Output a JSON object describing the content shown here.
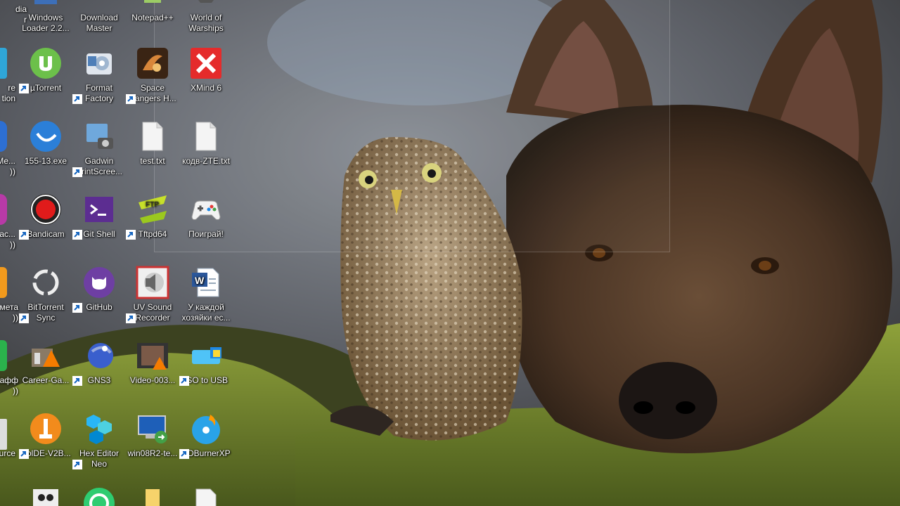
{
  "desktop": {
    "col0_labels": [
      "dia\nr",
      "re\ntion",
      "Me...\n))",
      "ас...\n))",
      "мета\n))",
      "кафф\n))",
      "urce"
    ],
    "icons": [
      {
        "key": "windows-loader",
        "label": "Windows Loader 2.2...",
        "icon": "windows-loader-icon"
      },
      {
        "key": "download-master",
        "label": "Download Master",
        "icon": "download-master-icon"
      },
      {
        "key": "notepad-plus",
        "label": "Notepad++",
        "icon": "notepad-plus-icon"
      },
      {
        "key": "world-of-warships",
        "label": "World of Warships",
        "icon": "world-of-warships-icon"
      },
      {
        "key": "utorrent",
        "label": "µTorrent",
        "icon": "utorrent-icon"
      },
      {
        "key": "format-factory",
        "label": "Format Factory",
        "icon": "format-factory-icon"
      },
      {
        "key": "space-rangers",
        "label": "Space Rangers H...",
        "icon": "space-rangers-icon"
      },
      {
        "key": "xmind",
        "label": "XMind 6",
        "icon": "xmind-icon"
      },
      {
        "key": "file-155",
        "label": "155-13.exe",
        "icon": "exe-icon"
      },
      {
        "key": "gadwin",
        "label": "Gadwin PrintScree...",
        "icon": "gadwin-icon"
      },
      {
        "key": "test-txt",
        "label": "test.txt",
        "icon": "text-file-icon"
      },
      {
        "key": "kodv-zte",
        "label": "кодв-ZTE.txt",
        "icon": "text-file-icon"
      },
      {
        "key": "bandicam",
        "label": "Bandicam",
        "icon": "bandicam-icon"
      },
      {
        "key": "git-shell",
        "label": "Git Shell",
        "icon": "git-shell-icon"
      },
      {
        "key": "tftpd64",
        "label": "Tftpd64",
        "icon": "tftpd-icon"
      },
      {
        "key": "pograi",
        "label": "Поиграй!",
        "icon": "gamepad-icon"
      },
      {
        "key": "bittorrent-sync",
        "label": "BitTorrent Sync",
        "icon": "bittorrent-sync-icon"
      },
      {
        "key": "github",
        "label": "GitHub",
        "icon": "github-icon"
      },
      {
        "key": "uv-sound",
        "label": "UV Sound Recorder",
        "icon": "uv-sound-icon"
      },
      {
        "key": "u-kazhdoy",
        "label": "У каждой хозяйки ес...",
        "icon": "word-doc-icon"
      },
      {
        "key": "career-game",
        "label": "Career-Ga...",
        "icon": "career-game-icon"
      },
      {
        "key": "gns3",
        "label": "GNS3",
        "icon": "gns3-icon"
      },
      {
        "key": "video-003",
        "label": "Video-003...",
        "icon": "video-file-icon"
      },
      {
        "key": "iso-to-usb",
        "label": "ISO to USB",
        "icon": "iso-to-usb-icon"
      },
      {
        "key": "colde",
        "label": "ColDE-V2B...",
        "icon": "colde-icon"
      },
      {
        "key": "hex-editor",
        "label": "Hex Editor Neo",
        "icon": "hex-editor-icon"
      },
      {
        "key": "win08r2",
        "label": "win08R2-te...",
        "icon": "rdp-icon"
      },
      {
        "key": "cdburnerxp",
        "label": "CDBurnerXP",
        "icon": "cdburnerxp-icon"
      }
    ]
  }
}
